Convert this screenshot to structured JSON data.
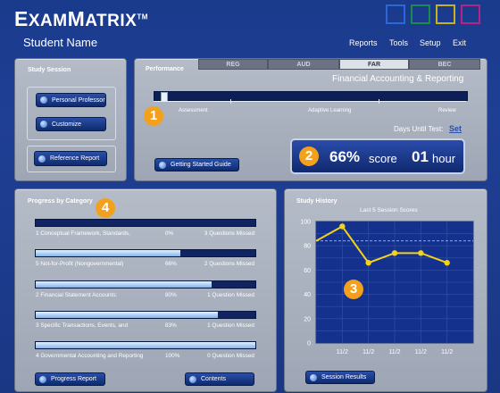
{
  "header": {
    "logo_first": "E",
    "logo_rest": "XAM",
    "logo_first2": "M",
    "logo_rest2": "ATRIX",
    "logo_tm": "TM",
    "square_colors": [
      "#2d67d6",
      "#1e8a4c",
      "#c9b21f",
      "#b3257e"
    ],
    "student_name": "Student Name",
    "nav": [
      "Reports",
      "Tools",
      "Setup",
      "Exit"
    ]
  },
  "study_session": {
    "title": "Study Session",
    "buttons": [
      "Personal Professor",
      "Customize",
      "Reference Report"
    ]
  },
  "performance": {
    "title": "Performance",
    "tabs": [
      "REG",
      "AUD",
      "FAR",
      "BEC"
    ],
    "active_tab": "FAR",
    "subject": "Financial Accounting & Reporting",
    "track_labels": [
      "Assessment",
      "Adaptive Learning",
      "Review"
    ],
    "progress_fraction": 0.02,
    "days_label": "Days Until Test:",
    "set_link": "Set",
    "score_value": "66%",
    "score_label": "score",
    "hour_value": "01",
    "hour_label": "hour",
    "guide_button": "Getting Started Guide"
  },
  "progress_by_category": {
    "title": "Progress by Category",
    "rows": [
      {
        "name": "1 Conceptual Framework, Standards,",
        "pct": "0%",
        "missed": "3 Questions Missed",
        "fraction": 0.0
      },
      {
        "name": "5 Not-for-Profit (Nongovernmental)",
        "pct": "66%",
        "missed": "2 Questions Missed",
        "fraction": 0.66
      },
      {
        "name": "2 Financial Statement Accounts:",
        "pct": "80%",
        "missed": "1 Question Missed",
        "fraction": 0.8
      },
      {
        "name": "3 Specific Transactions, Events, and",
        "pct": "83%",
        "missed": "1 Question Missed",
        "fraction": 0.83
      },
      {
        "name": "4 Governmental Accounting and Reporting",
        "pct": "100%",
        "missed": "0 Question Missed",
        "fraction": 1.0
      }
    ],
    "buttons": [
      "Progress Report",
      "Contents"
    ]
  },
  "study_history": {
    "title": "Study History",
    "button": "Session Results"
  },
  "callouts": [
    "1",
    "2",
    "3",
    "4"
  ],
  "chart_data": {
    "type": "line",
    "title": "Last 5 Session Scores",
    "x": [
      "",
      "11/2",
      "11/2",
      "11/2",
      "11/2",
      "11/2",
      ""
    ],
    "values": [
      84,
      96,
      66,
      74,
      74,
      66
    ],
    "ylim": [
      0,
      100
    ],
    "yticks": [
      0,
      20,
      40,
      60,
      80,
      100
    ],
    "reference_line": 84,
    "line_color": "#f2d21a",
    "grid": true
  }
}
